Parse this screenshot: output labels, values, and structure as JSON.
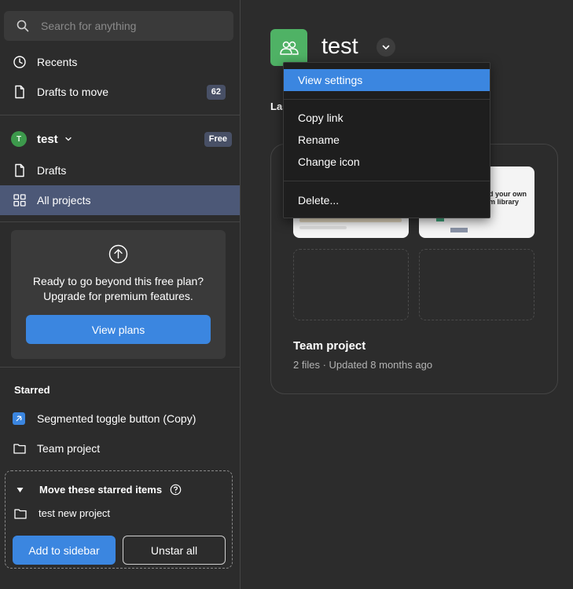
{
  "search": {
    "placeholder": "Search for anything"
  },
  "nav": {
    "recents": "Recents",
    "drafts_to_move": "Drafts to move",
    "drafts_to_move_count": "62"
  },
  "team": {
    "avatar_letter": "T",
    "name": "test",
    "plan_badge": "Free",
    "drafts": "Drafts",
    "all_projects": "All projects"
  },
  "upgrade": {
    "line1": "Ready to go beyond this free plan?",
    "line2": "Upgrade for premium features.",
    "button": "View plans"
  },
  "starred": {
    "title": "Starred",
    "items": [
      {
        "label": "Segmented toggle button (Copy)",
        "icon": "component-file-icon"
      },
      {
        "label": "Team project",
        "icon": "folder-icon"
      }
    ]
  },
  "move_box": {
    "title": "Move these starred items",
    "item": "test new project",
    "add_button": "Add to sidebar",
    "unstar_button": "Unstar all"
  },
  "main": {
    "team_title": "test",
    "section_heading": "Las",
    "project": {
      "title": "Team project",
      "meta": "2 files · Updated 8 months ago",
      "thumb_text_1": "ild your own",
      "thumb_text_2": "am library"
    }
  },
  "menu": {
    "items": [
      {
        "label": "View settings",
        "active": true
      },
      {
        "label": "Copy link"
      },
      {
        "label": "Rename"
      },
      {
        "label": "Change icon"
      },
      {
        "label": "Delete..."
      }
    ]
  },
  "colors": {
    "background": "#2c2c2c",
    "active_nav": "#4c5877",
    "accent_blue": "#3b86e0",
    "team_green": "#4fb265",
    "menu_bg": "#1e1e1e"
  }
}
